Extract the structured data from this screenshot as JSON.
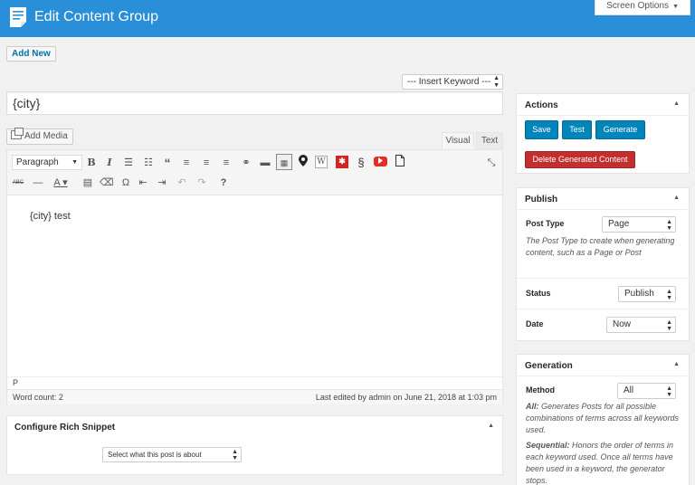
{
  "header": {
    "title": "Edit Content Group",
    "screen_options": "Screen Options"
  },
  "actions": {
    "add_new": "Add New",
    "insert_keyword": "--- Insert Keyword ---"
  },
  "post": {
    "title_value": "{city}",
    "body": "{city} test"
  },
  "editor": {
    "add_media": "Add Media",
    "tab_visual": "Visual",
    "tab_text": "Text",
    "format_select": "Paragraph",
    "path": "P",
    "word_count": "Word count: 2",
    "last_edited": "Last edited by admin on June 21, 2018 at 1:03 pm"
  },
  "snippet": {
    "title": "Configure Rich Snippet",
    "select_placeholder": "Select what this post is about"
  },
  "sidebar": {
    "actions_box": {
      "title": "Actions",
      "save": "Save",
      "test": "Test",
      "generate": "Generate",
      "delete": "Delete Generated Content"
    },
    "publish_box": {
      "title": "Publish",
      "post_type_label": "Post Type",
      "post_type_value": "Page",
      "post_type_help": "The Post Type to create when generating content, such as a Page or Post",
      "status_label": "Status",
      "status_value": "Publish",
      "date_label": "Date",
      "date_value": "Now"
    },
    "generation_box": {
      "title": "Generation",
      "method_label": "Method",
      "method_value": "All",
      "help_all_key": "All:",
      "help_all": " Generates Posts for all possible combinations of terms across all keywords used.",
      "help_seq_key": "Sequential:",
      "help_seq": " Honors the order of terms in each keyword used. Once all terms have been used in a keyword, the generator stops."
    }
  },
  "colors": {
    "header_bg": "#2a8fd9",
    "primary_button": "#0085ba",
    "danger_button": "#c12f2f",
    "link": "#0073aa"
  }
}
